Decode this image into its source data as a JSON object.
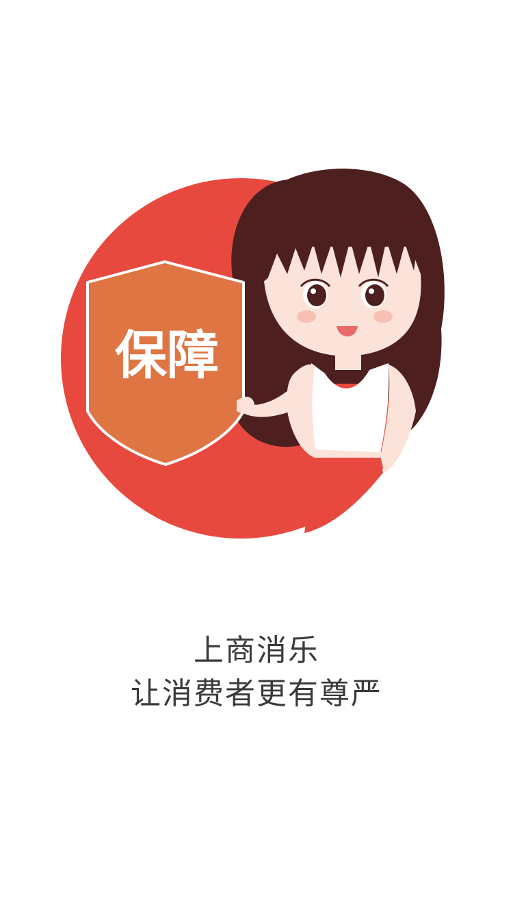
{
  "splash": {
    "badge_text": "保障",
    "tagline_line1": "上商消乐",
    "tagline_line2": "让消费者更有尊严"
  },
  "colors": {
    "circle": "#e8493f",
    "shield_fill": "#de7542",
    "shield_border": "#ffffff",
    "hair": "#4e1f1f",
    "skin": "#fbe3da",
    "top": "#ffffff",
    "text": "#3a3a3a"
  },
  "icons": {
    "illustration": "girl-holding-shield-illustration",
    "badge": "shield-icon"
  }
}
